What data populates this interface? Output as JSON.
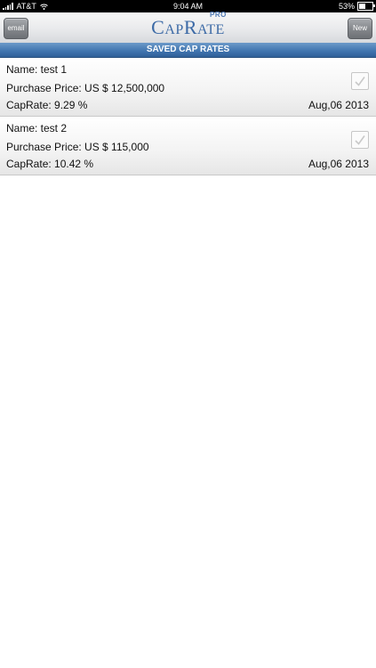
{
  "status_bar": {
    "carrier": "AT&T",
    "time": "9:04 AM",
    "battery": "53%",
    "battery_level": 0.53
  },
  "nav": {
    "email_label": "email",
    "new_label": "New",
    "logo_cap": "Cap",
    "logo_rate": "Rate",
    "logo_pro": "PRO"
  },
  "section": {
    "title": "SAVED CAP RATES"
  },
  "items": [
    {
      "name": "Name: test 1",
      "purchase_price": "Purchase Price: US $ 12,500,000",
      "cap_rate": "CapRate: 9.29 %",
      "date": "Aug,06 2013"
    },
    {
      "name": "Name: test 2",
      "purchase_price": "Purchase Price: US $ 115,000",
      "cap_rate": "CapRate: 10.42 %",
      "date": "Aug,06 2013"
    }
  ],
  "colors": {
    "accent": "#3f73ae",
    "logo": "#3c6aa6"
  }
}
